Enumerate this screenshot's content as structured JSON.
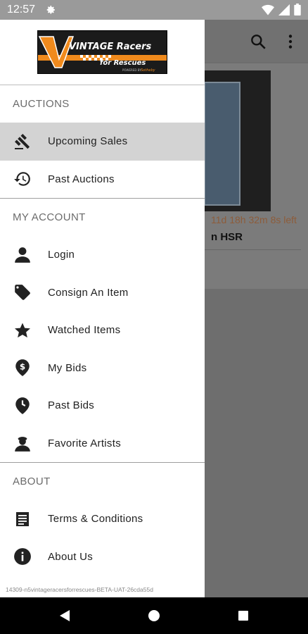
{
  "status_bar": {
    "time": "12:57"
  },
  "logo": {
    "line1": "VINTAGE Racers",
    "line2": "for Rescues",
    "powered_by": "POWERED BY"
  },
  "drawer": {
    "sections": [
      {
        "title": "AUCTIONS",
        "items": [
          {
            "label": "Upcoming Sales",
            "icon": "gavel-icon",
            "active": true
          },
          {
            "label": "Past Auctions",
            "icon": "history-icon"
          }
        ]
      },
      {
        "title": "MY ACCOUNT",
        "items": [
          {
            "label": "Login",
            "icon": "person-icon"
          },
          {
            "label": "Consign An Item",
            "icon": "tag-icon"
          },
          {
            "label": "Watched Items",
            "icon": "star-icon"
          },
          {
            "label": "My Bids",
            "icon": "dollar-pin-icon"
          },
          {
            "label": "Past Bids",
            "icon": "clock-pin-icon"
          },
          {
            "label": "Favorite Artists",
            "icon": "artist-icon"
          }
        ]
      },
      {
        "title": "ABOUT",
        "items": [
          {
            "label": "Terms & Conditions",
            "icon": "document-icon"
          },
          {
            "label": "About Us",
            "icon": "info-icon"
          }
        ]
      }
    ],
    "build": "14309-n5vintageracersforrescues-BETA-UAT-26cda55d"
  },
  "background": {
    "countdown": "11d 18h 32m 8s left",
    "title_fragment": "n HSR"
  },
  "colors": {
    "active_bg": "#d3d3d3",
    "logo_orange": "#f08a1c"
  }
}
